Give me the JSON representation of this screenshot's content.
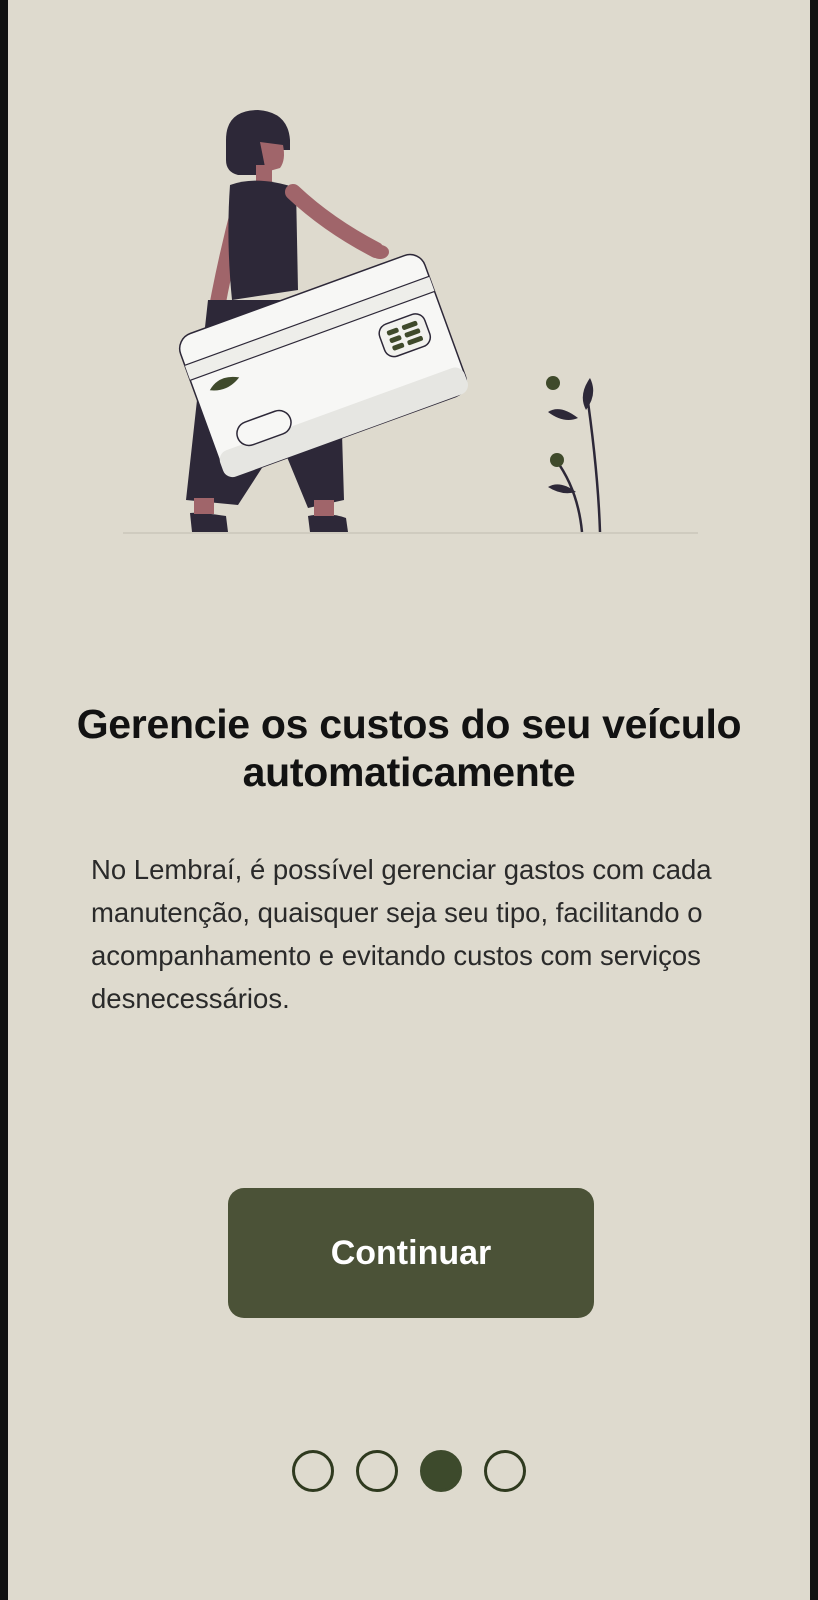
{
  "onboarding": {
    "title": "Gerencie os custos do seu veículo automaticamente",
    "description": "No Lembraí, é possível gerenciar gastos com cada manutenção, quaisquer seja seu tipo, facilitando o acompanhamento e evitando custos com serviços desnecessários.",
    "continue_label": "Continuar",
    "illustration": "woman-holding-credit-card-illustration"
  },
  "pager": {
    "total": 4,
    "active_index": 2
  },
  "colors": {
    "background": "#dedace",
    "button": "#4b5237",
    "button_text": "#ffffff",
    "dot_active": "#3d4a2c",
    "dot_border": "#2f3a1f",
    "figure_dark": "#2d2838",
    "skin": "#a0656a"
  }
}
